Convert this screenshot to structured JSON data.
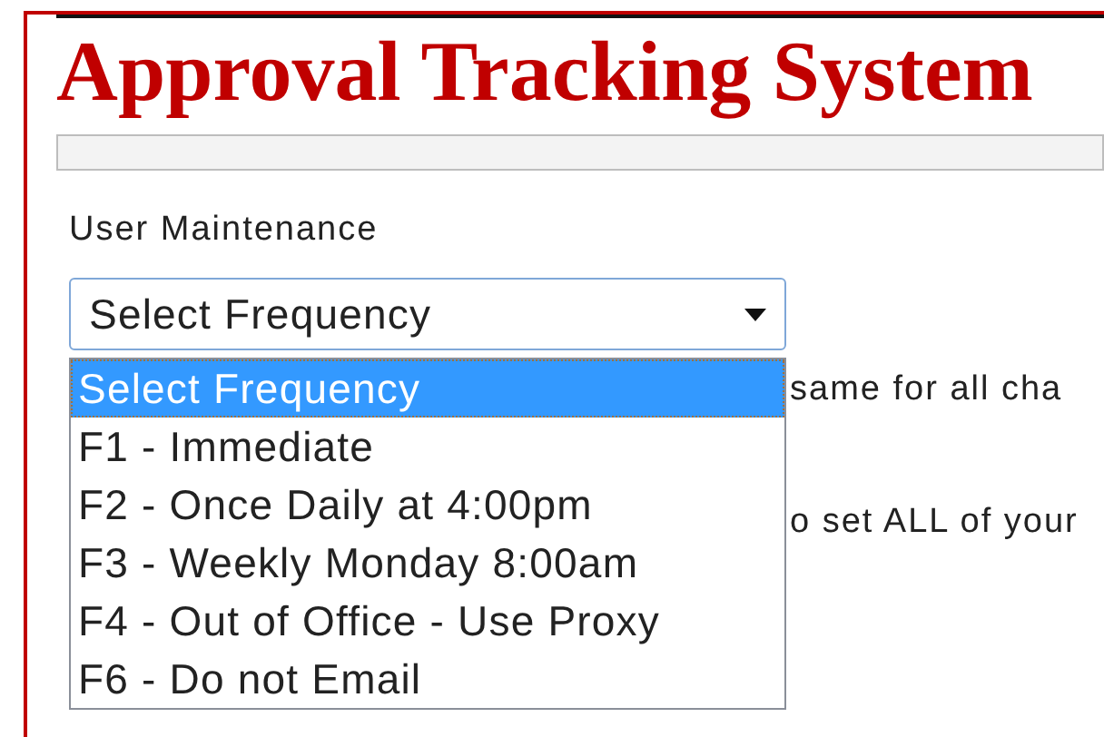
{
  "title": "Approval Tracking System",
  "section_label": "User Maintenance",
  "select": {
    "value": "Select Frequency",
    "expanded": true
  },
  "options": [
    {
      "label": "Select Frequency",
      "selected": true
    },
    {
      "label": "F1 - Immediate",
      "selected": false
    },
    {
      "label": "F2 - Once Daily at 4:00pm",
      "selected": false
    },
    {
      "label": "F3 - Weekly Monday 8:00am",
      "selected": false
    },
    {
      "label": "F4 - Out of Office - Use Proxy",
      "selected": false
    },
    {
      "label": "F6 - Do not Email",
      "selected": false
    }
  ],
  "background_lines": [
    "same for all cha",
    "o set ALL of your"
  ]
}
